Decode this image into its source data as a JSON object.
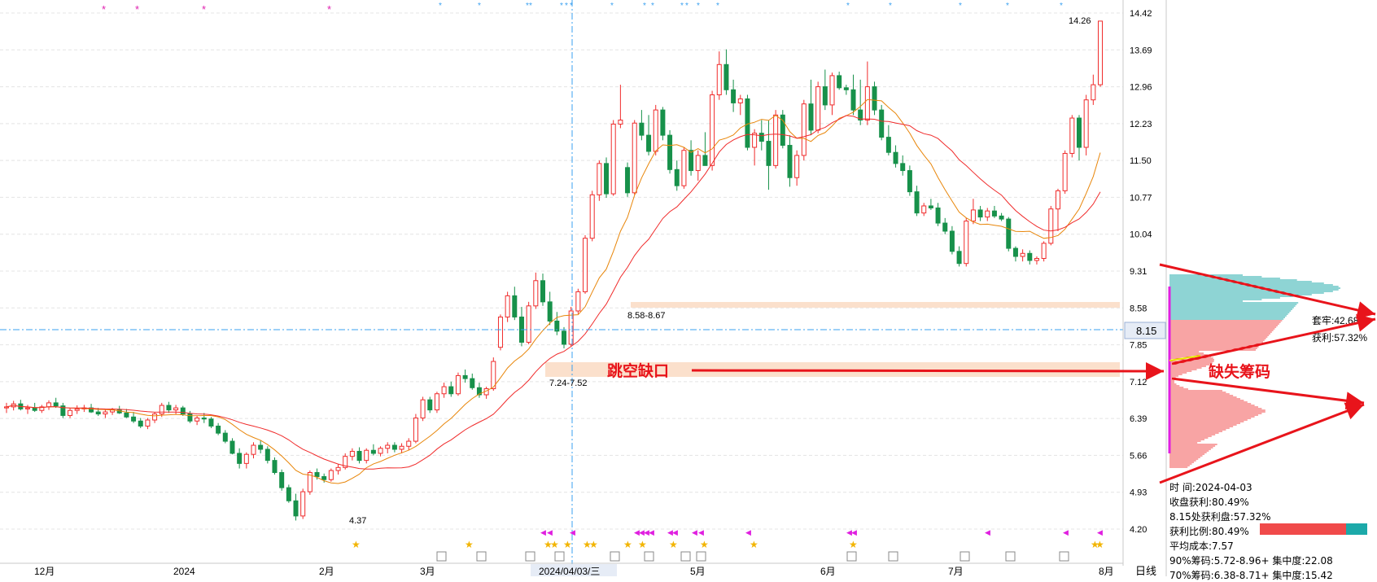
{
  "colors": {
    "up": "#f02b2b",
    "down": "#17914a",
    "ma_short": "#e8860a",
    "ma_long": "#f02b2b",
    "crosshair": "#3aa0f0",
    "chip_profit": "#f04a4a",
    "chip_loss": "#1ca9a9",
    "annotation": "#e8141b",
    "highlight": "#fbe0cc"
  },
  "chart_data": {
    "type": "candlestick",
    "price_axis": {
      "ticks": [
        "14.42",
        "13.69",
        "12.96",
        "12.23",
        "11.50",
        "10.77",
        "10.04",
        "9.31",
        "8.58",
        "7.85",
        "7.12",
        "6.39",
        "5.66",
        "4.93",
        "4.20"
      ],
      "range": [
        4.2,
        14.42
      ]
    },
    "time_axis": {
      "labels": [
        "12月",
        "2024",
        "2月",
        "3月",
        "2024/04/03/三",
        "5月",
        "6月",
        "7月",
        "8月"
      ],
      "period_label": "日线"
    },
    "crosshair": {
      "price_label": "8.15",
      "date_label": "2024/04/03/三"
    },
    "markers": {
      "low": "4.37",
      "high": "14.26",
      "gap_lower": "7.24-7.52",
      "gap_upper": "8.58-8.67"
    },
    "candles": [
      [
        6.6,
        6.7,
        6.5,
        6.62
      ],
      [
        6.62,
        6.74,
        6.55,
        6.68
      ],
      [
        6.68,
        6.76,
        6.55,
        6.58
      ],
      [
        6.58,
        6.66,
        6.48,
        6.6
      ],
      [
        6.6,
        6.7,
        6.52,
        6.55
      ],
      [
        6.55,
        6.66,
        6.5,
        6.62
      ],
      [
        6.62,
        6.75,
        6.56,
        6.7
      ],
      [
        6.7,
        6.8,
        6.6,
        6.64
      ],
      [
        6.64,
        6.7,
        6.4,
        6.45
      ],
      [
        6.45,
        6.6,
        6.4,
        6.55
      ],
      [
        6.55,
        6.65,
        6.48,
        6.58
      ],
      [
        6.58,
        6.66,
        6.52,
        6.6
      ],
      [
        6.6,
        6.68,
        6.5,
        6.52
      ],
      [
        6.52,
        6.6,
        6.44,
        6.48
      ],
      [
        6.48,
        6.56,
        6.4,
        6.52
      ],
      [
        6.52,
        6.6,
        6.46,
        6.56
      ],
      [
        6.56,
        6.64,
        6.48,
        6.5
      ],
      [
        6.5,
        6.58,
        6.4,
        6.42
      ],
      [
        6.42,
        6.52,
        6.3,
        6.34
      ],
      [
        6.34,
        6.4,
        6.2,
        6.24
      ],
      [
        6.24,
        6.4,
        6.18,
        6.36
      ],
      [
        6.36,
        6.52,
        6.3,
        6.48
      ],
      [
        6.48,
        6.7,
        6.42,
        6.65
      ],
      [
        6.65,
        6.72,
        6.5,
        6.56
      ],
      [
        6.56,
        6.66,
        6.48,
        6.6
      ],
      [
        6.6,
        6.64,
        6.44,
        6.48
      ],
      [
        6.48,
        6.54,
        6.3,
        6.34
      ],
      [
        6.34,
        6.44,
        6.26,
        6.4
      ],
      [
        6.4,
        6.5,
        6.3,
        6.38
      ],
      [
        6.38,
        6.42,
        6.2,
        6.24
      ],
      [
        6.24,
        6.3,
        6.06,
        6.1
      ],
      [
        6.1,
        6.16,
        5.9,
        5.94
      ],
      [
        5.94,
        6.0,
        5.68,
        5.7
      ],
      [
        5.7,
        5.8,
        5.4,
        5.5
      ],
      [
        5.5,
        5.72,
        5.4,
        5.68
      ],
      [
        5.68,
        5.92,
        5.6,
        5.86
      ],
      [
        5.86,
        5.96,
        5.7,
        5.78
      ],
      [
        5.78,
        5.84,
        5.5,
        5.56
      ],
      [
        5.56,
        5.62,
        5.28,
        5.32
      ],
      [
        5.32,
        5.38,
        4.96,
        5.02
      ],
      [
        5.02,
        5.08,
        4.72,
        4.76
      ],
      [
        4.76,
        4.9,
        4.37,
        4.46
      ],
      [
        4.46,
        5.0,
        4.4,
        4.94
      ],
      [
        4.94,
        5.36,
        4.88,
        5.32
      ],
      [
        5.32,
        5.4,
        5.18,
        5.24
      ],
      [
        5.24,
        5.3,
        5.12,
        5.18
      ],
      [
        5.18,
        5.4,
        5.14,
        5.36
      ],
      [
        5.36,
        5.48,
        5.28,
        5.42
      ],
      [
        5.42,
        5.7,
        5.38,
        5.64
      ],
      [
        5.64,
        5.8,
        5.56,
        5.74
      ],
      [
        5.74,
        5.82,
        5.5,
        5.56
      ],
      [
        5.56,
        5.8,
        5.5,
        5.76
      ],
      [
        5.76,
        5.88,
        5.66,
        5.7
      ],
      [
        5.7,
        5.84,
        5.64,
        5.8
      ],
      [
        5.8,
        5.92,
        5.7,
        5.86
      ],
      [
        5.86,
        5.92,
        5.72,
        5.78
      ],
      [
        5.78,
        5.9,
        5.7,
        5.84
      ],
      [
        5.84,
        6.0,
        5.76,
        5.94
      ],
      [
        5.94,
        6.48,
        5.9,
        6.4
      ],
      [
        6.4,
        6.82,
        6.34,
        6.76
      ],
      [
        6.76,
        6.82,
        6.5,
        6.56
      ],
      [
        6.56,
        6.92,
        6.5,
        6.88
      ],
      [
        6.88,
        7.1,
        6.8,
        7.02
      ],
      [
        7.02,
        7.12,
        6.82,
        6.88
      ],
      [
        6.88,
        7.3,
        6.84,
        7.24
      ],
      [
        7.24,
        7.36,
        7.1,
        7.18
      ],
      [
        7.18,
        7.28,
        6.96,
        7.0
      ],
      [
        7.0,
        7.1,
        6.8,
        6.86
      ],
      [
        6.86,
        7.02,
        6.78,
        6.98
      ],
      [
        6.98,
        7.6,
        6.94,
        7.52
      ],
      [
        7.8,
        8.45,
        7.74,
        8.4
      ],
      [
        8.4,
        8.9,
        8.3,
        8.82
      ],
      [
        8.82,
        9.0,
        8.34,
        8.4
      ],
      [
        8.4,
        8.6,
        7.82,
        7.9
      ],
      [
        7.9,
        8.7,
        7.86,
        8.62
      ],
      [
        8.62,
        9.28,
        8.56,
        9.12
      ],
      [
        9.12,
        9.26,
        8.62,
        8.7
      ],
      [
        8.7,
        8.9,
        8.24,
        8.32
      ],
      [
        8.32,
        8.5,
        8.04,
        8.12
      ],
      [
        8.12,
        8.2,
        7.78,
        7.86
      ],
      [
        7.86,
        8.6,
        7.82,
        8.52
      ],
      [
        8.52,
        8.96,
        8.46,
        8.9
      ],
      [
        8.9,
        10.02,
        8.86,
        9.96
      ],
      [
        9.96,
        10.9,
        9.9,
        10.82
      ],
      [
        10.82,
        11.5,
        10.7,
        11.44
      ],
      [
        11.44,
        11.56,
        10.76,
        10.84
      ],
      [
        10.84,
        12.3,
        10.8,
        12.22
      ],
      [
        12.22,
        13.0,
        12.14,
        12.3
      ],
      [
        11.36,
        11.46,
        10.78,
        10.86
      ],
      [
        10.86,
        12.3,
        10.82,
        12.24
      ],
      [
        12.24,
        12.5,
        11.9,
        12.0
      ],
      [
        12.0,
        12.4,
        11.6,
        11.68
      ],
      [
        11.68,
        12.6,
        11.6,
        12.5
      ],
      [
        12.5,
        12.56,
        11.9,
        12.0
      ],
      [
        12.0,
        12.1,
        11.24,
        11.32
      ],
      [
        11.32,
        11.5,
        10.9,
        11.0
      ],
      [
        11.0,
        11.76,
        10.94,
        11.7
      ],
      [
        11.7,
        11.9,
        11.2,
        11.3
      ],
      [
        11.3,
        11.7,
        11.1,
        11.6
      ],
      [
        11.6,
        12.06,
        11.5,
        11.4
      ],
      [
        11.4,
        12.88,
        11.3,
        12.8
      ],
      [
        12.8,
        13.66,
        12.7,
        13.4
      ],
      [
        13.4,
        13.7,
        12.8,
        12.9
      ],
      [
        12.9,
        13.1,
        12.46,
        12.64
      ],
      [
        12.64,
        12.8,
        12.4,
        12.72
      ],
      [
        12.72,
        12.8,
        11.7,
        11.76
      ],
      [
        11.76,
        12.12,
        11.4,
        12.04
      ],
      [
        12.04,
        12.3,
        11.7,
        11.88
      ],
      [
        11.88,
        12.3,
        10.92,
        11.4
      ],
      [
        11.4,
        12.5,
        11.34,
        12.4
      ],
      [
        12.4,
        12.5,
        11.74,
        11.8
      ],
      [
        11.8,
        12.0,
        10.98,
        11.16
      ],
      [
        11.16,
        11.7,
        11.0,
        11.6
      ],
      [
        11.6,
        12.7,
        11.5,
        12.62
      ],
      [
        12.62,
        13.1,
        12.0,
        12.1
      ],
      [
        12.1,
        13.06,
        12.04,
        12.96
      ],
      [
        12.96,
        13.3,
        12.5,
        12.6
      ],
      [
        12.6,
        13.24,
        12.4,
        13.18
      ],
      [
        13.18,
        13.26,
        12.9,
        12.94
      ],
      [
        12.94,
        13.0,
        12.8,
        12.9
      ],
      [
        12.9,
        13.2,
        12.4,
        12.5
      ],
      [
        12.5,
        13.1,
        12.2,
        12.3
      ],
      [
        12.3,
        13.46,
        12.2,
        12.96
      ],
      [
        12.96,
        13.06,
        12.4,
        12.5
      ],
      [
        12.5,
        12.6,
        11.9,
        11.96
      ],
      [
        11.96,
        12.2,
        11.6,
        11.66
      ],
      [
        11.66,
        11.8,
        11.36,
        11.44
      ],
      [
        11.44,
        11.6,
        11.2,
        11.3
      ],
      [
        11.3,
        11.4,
        10.8,
        10.88
      ],
      [
        10.88,
        11.0,
        10.4,
        10.46
      ],
      [
        10.46,
        10.66,
        10.4,
        10.6
      ],
      [
        10.6,
        10.74,
        10.52,
        10.56
      ],
      [
        10.56,
        10.66,
        10.2,
        10.26
      ],
      [
        10.26,
        10.36,
        10.04,
        10.1
      ],
      [
        10.1,
        10.2,
        9.64,
        9.7
      ],
      [
        9.7,
        9.8,
        9.4,
        9.46
      ],
      [
        9.46,
        10.36,
        9.4,
        10.3
      ],
      [
        10.3,
        10.74,
        10.24,
        10.52
      ],
      [
        10.52,
        10.6,
        10.3,
        10.38
      ],
      [
        10.38,
        10.56,
        10.3,
        10.5
      ],
      [
        10.5,
        10.6,
        10.36,
        10.4
      ],
      [
        10.4,
        10.46,
        10.3,
        10.34
      ],
      [
        10.34,
        10.38,
        9.7,
        9.76
      ],
      [
        9.76,
        9.8,
        9.5,
        9.6
      ],
      [
        9.6,
        9.74,
        9.5,
        9.66
      ],
      [
        9.66,
        9.72,
        9.44,
        9.52
      ],
      [
        9.52,
        9.6,
        9.44,
        9.56
      ],
      [
        9.56,
        9.9,
        9.5,
        9.86
      ],
      [
        9.86,
        10.6,
        9.82,
        10.54
      ],
      [
        10.54,
        10.94,
        10.1,
        10.9
      ],
      [
        10.9,
        11.7,
        10.84,
        11.64
      ],
      [
        11.64,
        12.4,
        11.56,
        12.34
      ],
      [
        12.34,
        12.4,
        11.5,
        11.76
      ],
      [
        11.76,
        12.8,
        11.6,
        12.7
      ],
      [
        12.7,
        13.2,
        12.6,
        13.0
      ],
      [
        13.0,
        14.26,
        12.96,
        14.26
      ]
    ]
  },
  "chip_panel": {
    "legend_loss": "套牢:42.68%",
    "legend_profit": "获利:57.32%",
    "info": {
      "time": "时      间:2024-04-03",
      "close_profit": "收盘获利:80.49%",
      "price_profit": "8.15处获利盘:57.32%",
      "profit_ratio_label": "获利比例:80.49%",
      "profit_ratio": 0.8049,
      "avg_cost": "平均成本:7.57",
      "chip90": "90%筹码:5.72-8.96+ 集中度:22.08",
      "chip70": "70%筹码:6.38-8.71+ 集中度:15.42"
    }
  },
  "annotations": {
    "gap_text": "跳空缺口",
    "missing_chips_text": "缺失筹码"
  }
}
